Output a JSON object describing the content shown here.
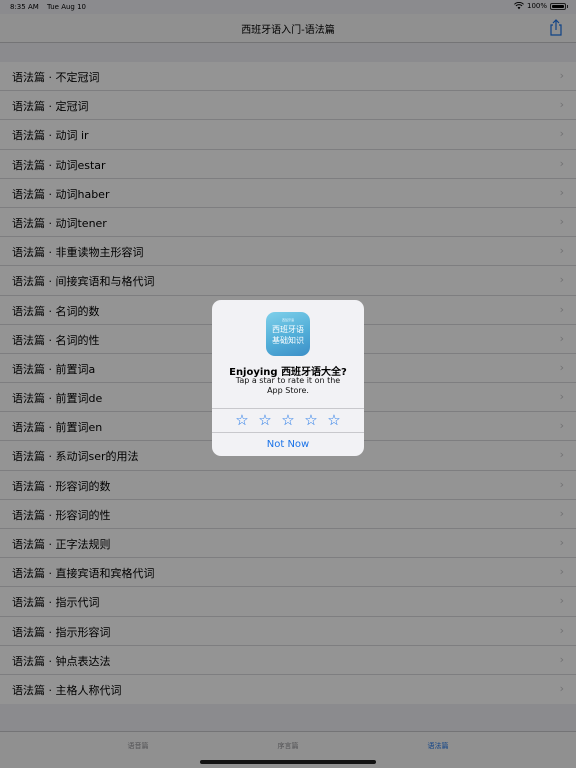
{
  "status_bar": {
    "time": "8:35 AM",
    "date": "Tue Aug 10",
    "battery": "100%",
    "battery_level": 1.0
  },
  "nav": {
    "title": "西班牙语入门-语法篇"
  },
  "list": {
    "items": [
      "语法篇 · 不定冠词",
      "语法篇 · 定冠词",
      "语法篇 · 动词 ir",
      "语法篇 · 动词estar",
      "语法篇 · 动词haber",
      "语法篇 · 动词tener",
      "语法篇 · 非重读物主形容词",
      "语法篇 · 间接宾语和与格代词",
      "语法篇 · 名词的数",
      "语法篇 · 名词的性",
      "语法篇 · 前置词a",
      "语法篇 · 前置词de",
      "语法篇 · 前置词en",
      "语法篇 · 系动词ser的用法",
      "语法篇 · 形容词的数",
      "语法篇 · 形容词的性",
      "语法篇 · 正字法规则",
      "语法篇 · 直接宾语和宾格代词",
      "语法篇 · 指示代词",
      "语法篇 · 指示形容词",
      "语法篇 · 钟点表达法",
      "语法篇 · 主格人称代词"
    ],
    "chevron": "›"
  },
  "tabs": [
    {
      "label": "语音篇",
      "active": false
    },
    {
      "label": "序言篇",
      "active": false
    },
    {
      "label": "语法篇",
      "active": true
    }
  ],
  "alert": {
    "icon_small_text": "西班牙语",
    "icon_line1": "西班牙语",
    "icon_line2": "基础知识",
    "title": "Enjoying 西班牙语大全?",
    "message": "Tap a star to rate it on the App Store.",
    "star_glyph": "☆",
    "star_count": 5,
    "button": "Not Now"
  },
  "colors": {
    "accent": "#1a73e8",
    "overlay": "rgba(0,0,0,0.42)"
  }
}
